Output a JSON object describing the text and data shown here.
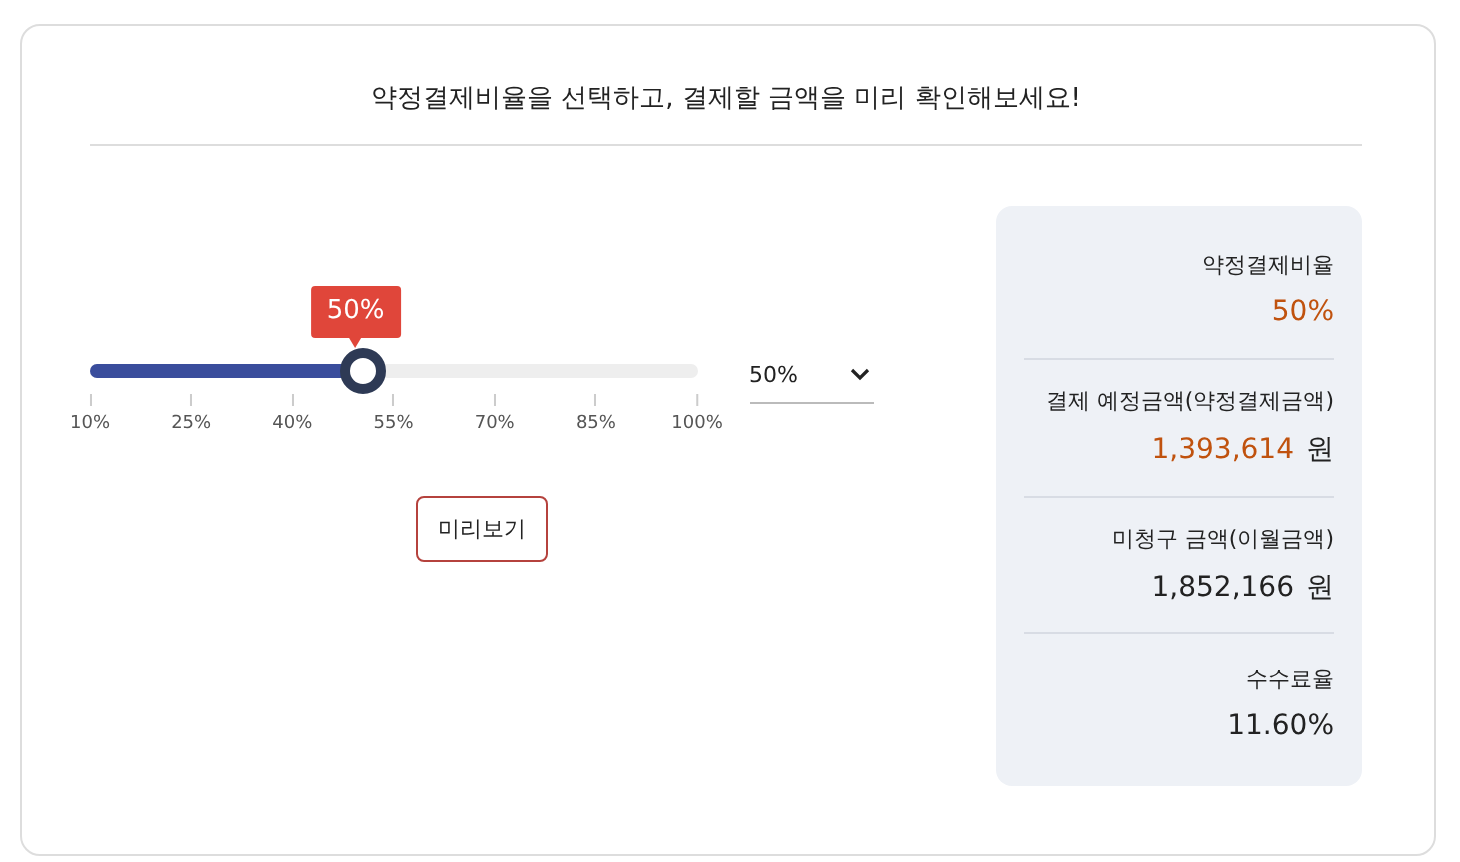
{
  "title": "약정결제비율을 선택하고, 결제할 금액을 미리 확인해보세요!",
  "slider": {
    "level": 0.444,
    "tooltip": "50%",
    "ticks": [
      "10%",
      "25%",
      "40%",
      "55%",
      "70%",
      "85%",
      "100%"
    ]
  },
  "select": {
    "value": "50%"
  },
  "preview_button": "미리보기",
  "summary": [
    {
      "label": "약정결제비율",
      "value": "50%",
      "accent": true
    },
    {
      "label": "결제 예정금액(약정결제금액)",
      "value": "1,393,614",
      "unit": "원",
      "accent": true
    },
    {
      "label": "미청구 금액(이월금액)",
      "value": "1,852,166",
      "unit": "원",
      "accent": false
    },
    {
      "label": "수수료율",
      "value": "11.60%",
      "accent": false
    }
  ]
}
